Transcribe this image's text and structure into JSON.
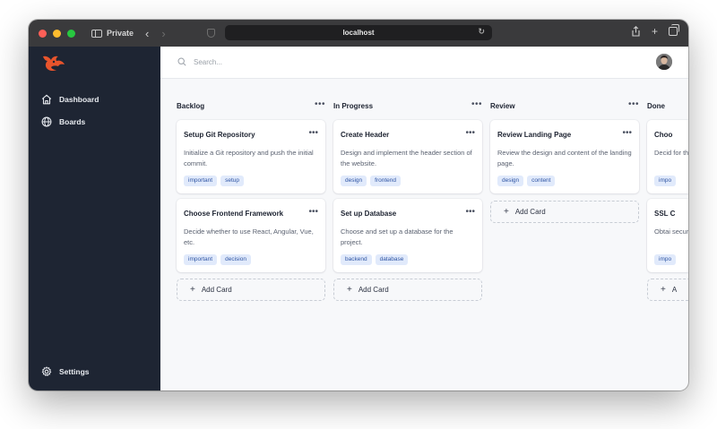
{
  "browser": {
    "private_label": "Private",
    "url": "localhost"
  },
  "sidebar": {
    "items": [
      {
        "label": "Dashboard",
        "icon": "home-icon"
      },
      {
        "label": "Boards",
        "icon": "globe-icon"
      }
    ],
    "settings_label": "Settings"
  },
  "search": {
    "placeholder": "Search..."
  },
  "colors": {
    "sidebar_bg": "#1e2533",
    "accent_logo": "#e8542c",
    "tag_bg": "#e1eafb",
    "tag_text": "#2f55a4"
  },
  "columns": [
    {
      "title": "Backlog",
      "cards": [
        {
          "title": "Setup Git Repository",
          "description": "Initialize a Git repository and push the initial commit.",
          "tags": [
            "important",
            "setup"
          ]
        },
        {
          "title": "Choose Frontend Framework",
          "description": "Decide whether to use React, Angular, Vue, etc.",
          "tags": [
            "important",
            "decision"
          ]
        }
      ],
      "add_label": "Add Card"
    },
    {
      "title": "In Progress",
      "cards": [
        {
          "title": "Create Header",
          "description": "Design and implement the header section of the website.",
          "tags": [
            "design",
            "frontend"
          ]
        },
        {
          "title": "Set up Database",
          "description": "Choose and set up a database for the project.",
          "tags": [
            "backend",
            "database"
          ]
        }
      ],
      "add_label": "Add Card"
    },
    {
      "title": "Review",
      "cards": [
        {
          "title": "Review Landing Page",
          "description": "Review the design and content of the landing page.",
          "tags": [
            "design",
            "content"
          ]
        }
      ],
      "add_label": "Add Card"
    },
    {
      "title": "Done",
      "cards": [
        {
          "title": "Choo",
          "description": "Decid for th",
          "tags": [
            "impo"
          ]
        },
        {
          "title": "SSL C",
          "description": "Obtai secur",
          "tags": [
            "impo"
          ]
        }
      ],
      "add_label": "A"
    }
  ]
}
